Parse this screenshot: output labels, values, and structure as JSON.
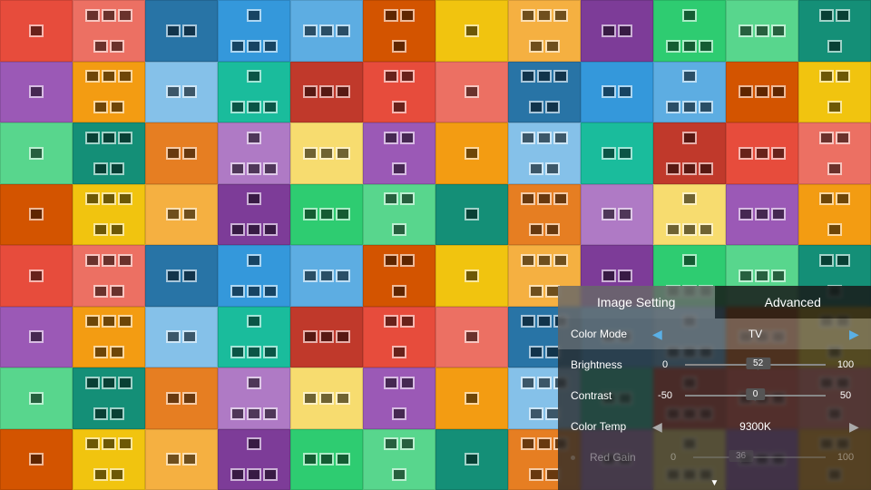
{
  "panel": {
    "tabs": {
      "image_setting": "Image Setting",
      "advanced": "Advanced"
    },
    "color_mode": {
      "label": "Color Mode",
      "value": "TV"
    },
    "brightness": {
      "label": "Brightness",
      "min": "0",
      "max": "100",
      "value": "52",
      "percent": 52
    },
    "contrast": {
      "label": "Contrast",
      "min": "-50",
      "max": "50",
      "value": "0",
      "percent": 50
    },
    "color_temp": {
      "label": "Color Temp",
      "value": "9300K"
    },
    "red_gain": {
      "label": "Red Gain",
      "min": "0",
      "max": "100",
      "value": "36",
      "percent": 36
    }
  },
  "scroll_hint": "▼"
}
